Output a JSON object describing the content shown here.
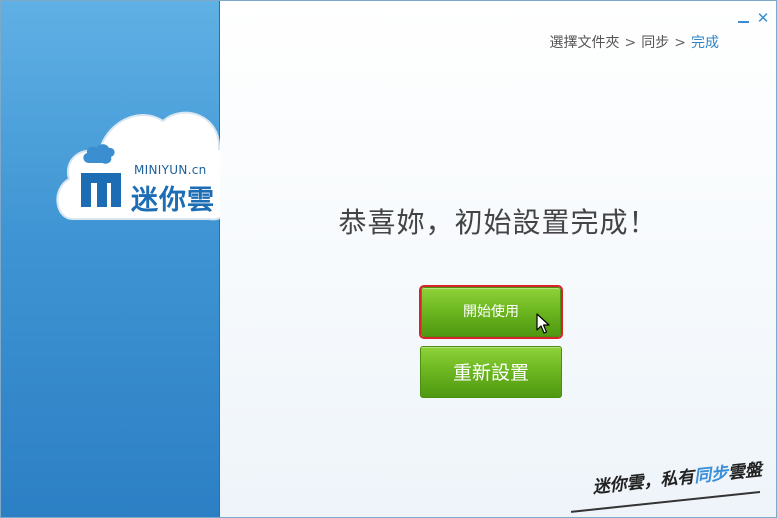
{
  "brand": {
    "latin": "MINIYUN.cn",
    "chinese": "迷你雲"
  },
  "window_controls": {
    "minimize_icon": "minimize-icon",
    "close_icon": "close-icon",
    "close_glyph": "✕"
  },
  "breadcrumb": {
    "steps": [
      "選擇文件夾",
      "同步",
      "完成"
    ],
    "separator": ">",
    "current_index": 2
  },
  "headline": "恭喜妳，初始設置完成！",
  "buttons": {
    "start": "開始使用",
    "reset": "重新設置"
  },
  "slogan": {
    "part1": "迷你雲，私有",
    "accent": "同步",
    "part2": "雲盤"
  },
  "colors": {
    "sidebar": "#3f95d3",
    "accent": "#2e86c9",
    "button_green": "#6ab51f",
    "highlight": "#d9232b"
  }
}
